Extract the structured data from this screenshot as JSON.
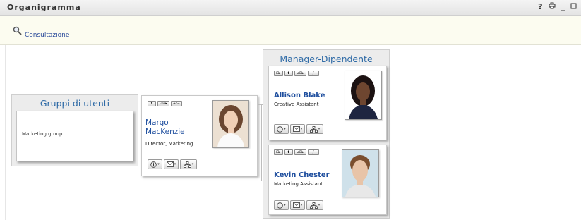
{
  "window": {
    "title": "Organigramma",
    "controls": {
      "help": "?",
      "print": "🖶",
      "minimize": "_",
      "restore": "□"
    }
  },
  "toolbar": {
    "browse_label": "Consultazione"
  },
  "groups_panel": {
    "title": "Gruppi di utenti",
    "items": [
      "Marketing group"
    ]
  },
  "focus_person": {
    "name_line1": "Margo",
    "name_line2": "MacKenzie",
    "title": "Director, Marketing",
    "mini_buttons": [
      "⬆",
      "⊿⊞▸",
      "+/−"
    ]
  },
  "reports_panel": {
    "title": "Manager-Dipendente",
    "people": [
      {
        "name": "Allison Blake",
        "title": "Creative Assistant",
        "mini_buttons": [
          "⊟▸",
          "⬆",
          "⊿⊞▸",
          "+/−"
        ]
      },
      {
        "name": "Kevin Chester",
        "title": "Marketing Assistant",
        "mini_buttons": [
          "⊟▸",
          "⬆",
          "⊿⊞▸",
          "+/−"
        ]
      }
    ]
  },
  "action_icons": [
    "info-icon",
    "email-icon",
    "org-chart-icon"
  ]
}
